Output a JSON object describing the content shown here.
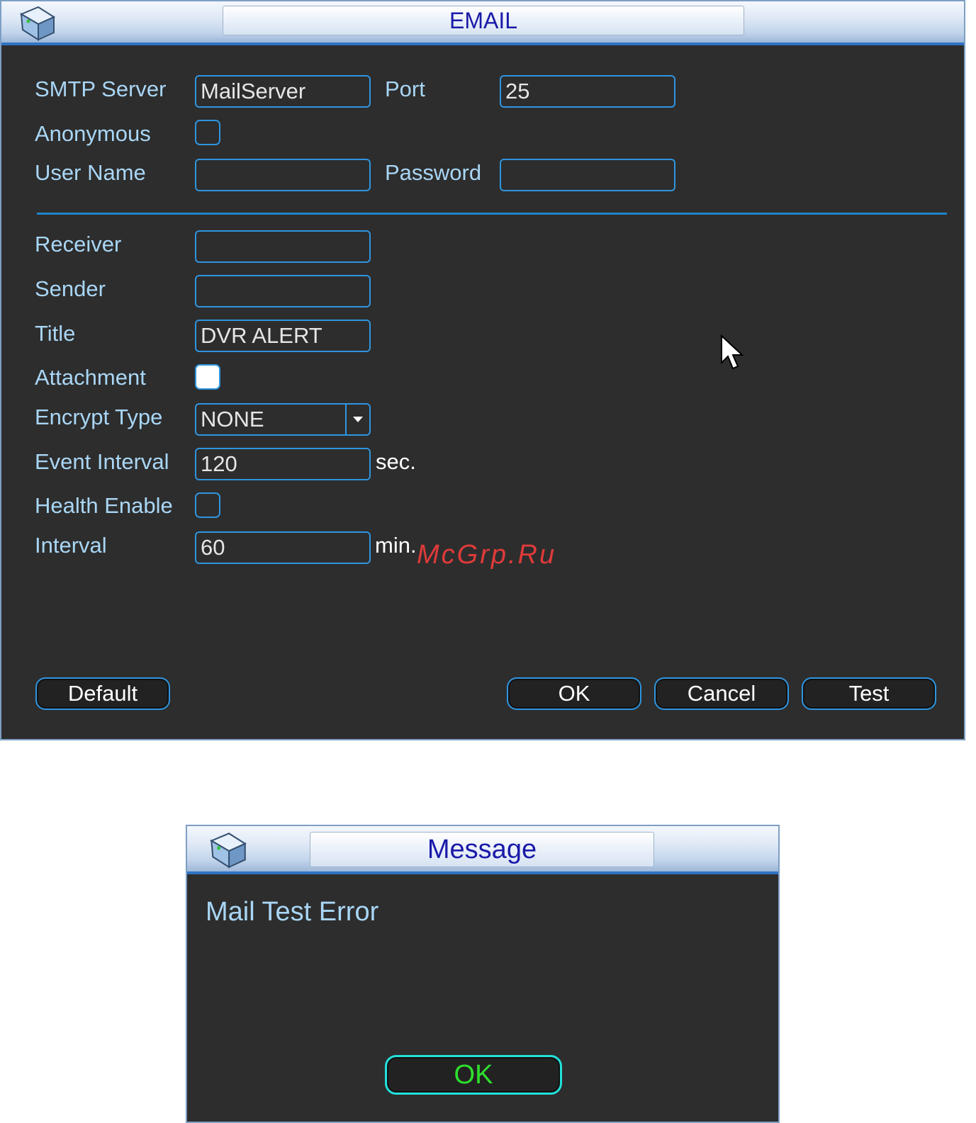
{
  "email_window": {
    "title": "EMAIL",
    "fields": {
      "smtp_server": {
        "label": "SMTP Server",
        "value": "MailServer"
      },
      "port": {
        "label": "Port",
        "value": "25"
      },
      "anonymous": {
        "label": "Anonymous",
        "checked": false
      },
      "user_name": {
        "label": "User Name",
        "value": ""
      },
      "password": {
        "label": "Password",
        "value": ""
      },
      "receiver": {
        "label": "Receiver",
        "value": ""
      },
      "sender": {
        "label": "Sender",
        "value": ""
      },
      "title": {
        "label": "Title",
        "value": "DVR ALERT"
      },
      "attachment": {
        "label": "Attachment",
        "checked": true
      },
      "encrypt_type": {
        "label": "Encrypt Type",
        "value": "NONE"
      },
      "event_interval": {
        "label": "Event Interval",
        "value": "120",
        "unit": "sec."
      },
      "health_enable": {
        "label": "Health Enable",
        "checked": false
      },
      "interval": {
        "label": "Interval",
        "value": "60",
        "unit": "min."
      }
    },
    "buttons": {
      "default": "Default",
      "ok": "OK",
      "cancel": "Cancel",
      "test": "Test"
    }
  },
  "message_window": {
    "title": "Message",
    "text": "Mail Test Error",
    "ok_label": "OK"
  },
  "watermark": "McGrp.Ru",
  "colors": {
    "panel_bg": "#2d2d2d",
    "label": "#a9d6f5",
    "field_border": "#2f95df",
    "title_text": "#1a1aa8",
    "ok_green": "#2ee02e",
    "ok_border": "#22e1d9"
  }
}
